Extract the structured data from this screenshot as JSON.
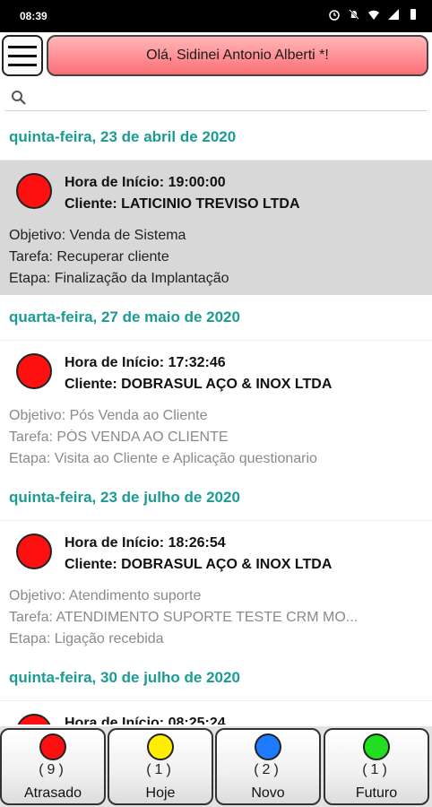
{
  "status_bar": {
    "time": "08:39",
    "icons": [
      "alarm-icon",
      "mute-icon",
      "wifi-icon",
      "signal-4g-icon",
      "battery-icon"
    ]
  },
  "header": {
    "menu_icon": "hamburger-icon",
    "greeting": "Olá, Sidinei Antonio Alberti *!"
  },
  "search": {
    "icon": "search-icon",
    "value": "",
    "placeholder": ""
  },
  "groups": [
    {
      "date": "quinta-feira, 23 de abril de 2020",
      "items": [
        {
          "selected": true,
          "status_color": "#ff1010",
          "hora": "Hora de Início: 19:00:00",
          "cliente": "Cliente: LATICINIO TREVISO LTDA",
          "objetivo": "Objetivo: Venda de Sistema",
          "tarefa": "Tarefa: Recuperar cliente",
          "etapa": "Etapa: Finalização da Implantação"
        }
      ]
    },
    {
      "date": "quarta-feira, 27 de maio de 2020",
      "items": [
        {
          "selected": false,
          "status_color": "#ff1010",
          "hora": "Hora de Início: 17:32:46",
          "cliente": "Cliente: DOBRASUL AÇO & INOX LTDA",
          "objetivo": "Objetivo: Pós Venda ao Cliente",
          "tarefa": "Tarefa: PÓS VENDA AO CLIENTE",
          "etapa": "Etapa: Visita ao Cliente e Aplicação questionario"
        }
      ]
    },
    {
      "date": "quinta-feira, 23 de julho de 2020",
      "items": [
        {
          "selected": false,
          "status_color": "#ff1010",
          "hora": "Hora de Início: 18:26:54",
          "cliente": "Cliente: DOBRASUL AÇO & INOX LTDA",
          "objetivo": "Objetivo: Atendimento suporte",
          "tarefa": "Tarefa: ATENDIMENTO SUPORTE TESTE CRM MO...",
          "etapa": "Etapa: Ligação recebida"
        }
      ]
    },
    {
      "date": "quinta-feira, 30 de julho de 2020",
      "items": [
        {
          "selected": false,
          "status_color": "#ff1010",
          "hora": "Hora de Início: 08:25:24",
          "cliente": "",
          "objetivo": "",
          "tarefa": "",
          "etapa": ""
        }
      ]
    }
  ],
  "bottom_tabs": [
    {
      "label": "Atrasado",
      "count": "(9)",
      "color": "#ff1010"
    },
    {
      "label": "Hoje",
      "count": "(1)",
      "color": "#ffee00"
    },
    {
      "label": "Novo",
      "count": "(2)",
      "color": "#1e7bff"
    },
    {
      "label": "Futuro",
      "count": "(1)",
      "color": "#22dd22"
    }
  ]
}
